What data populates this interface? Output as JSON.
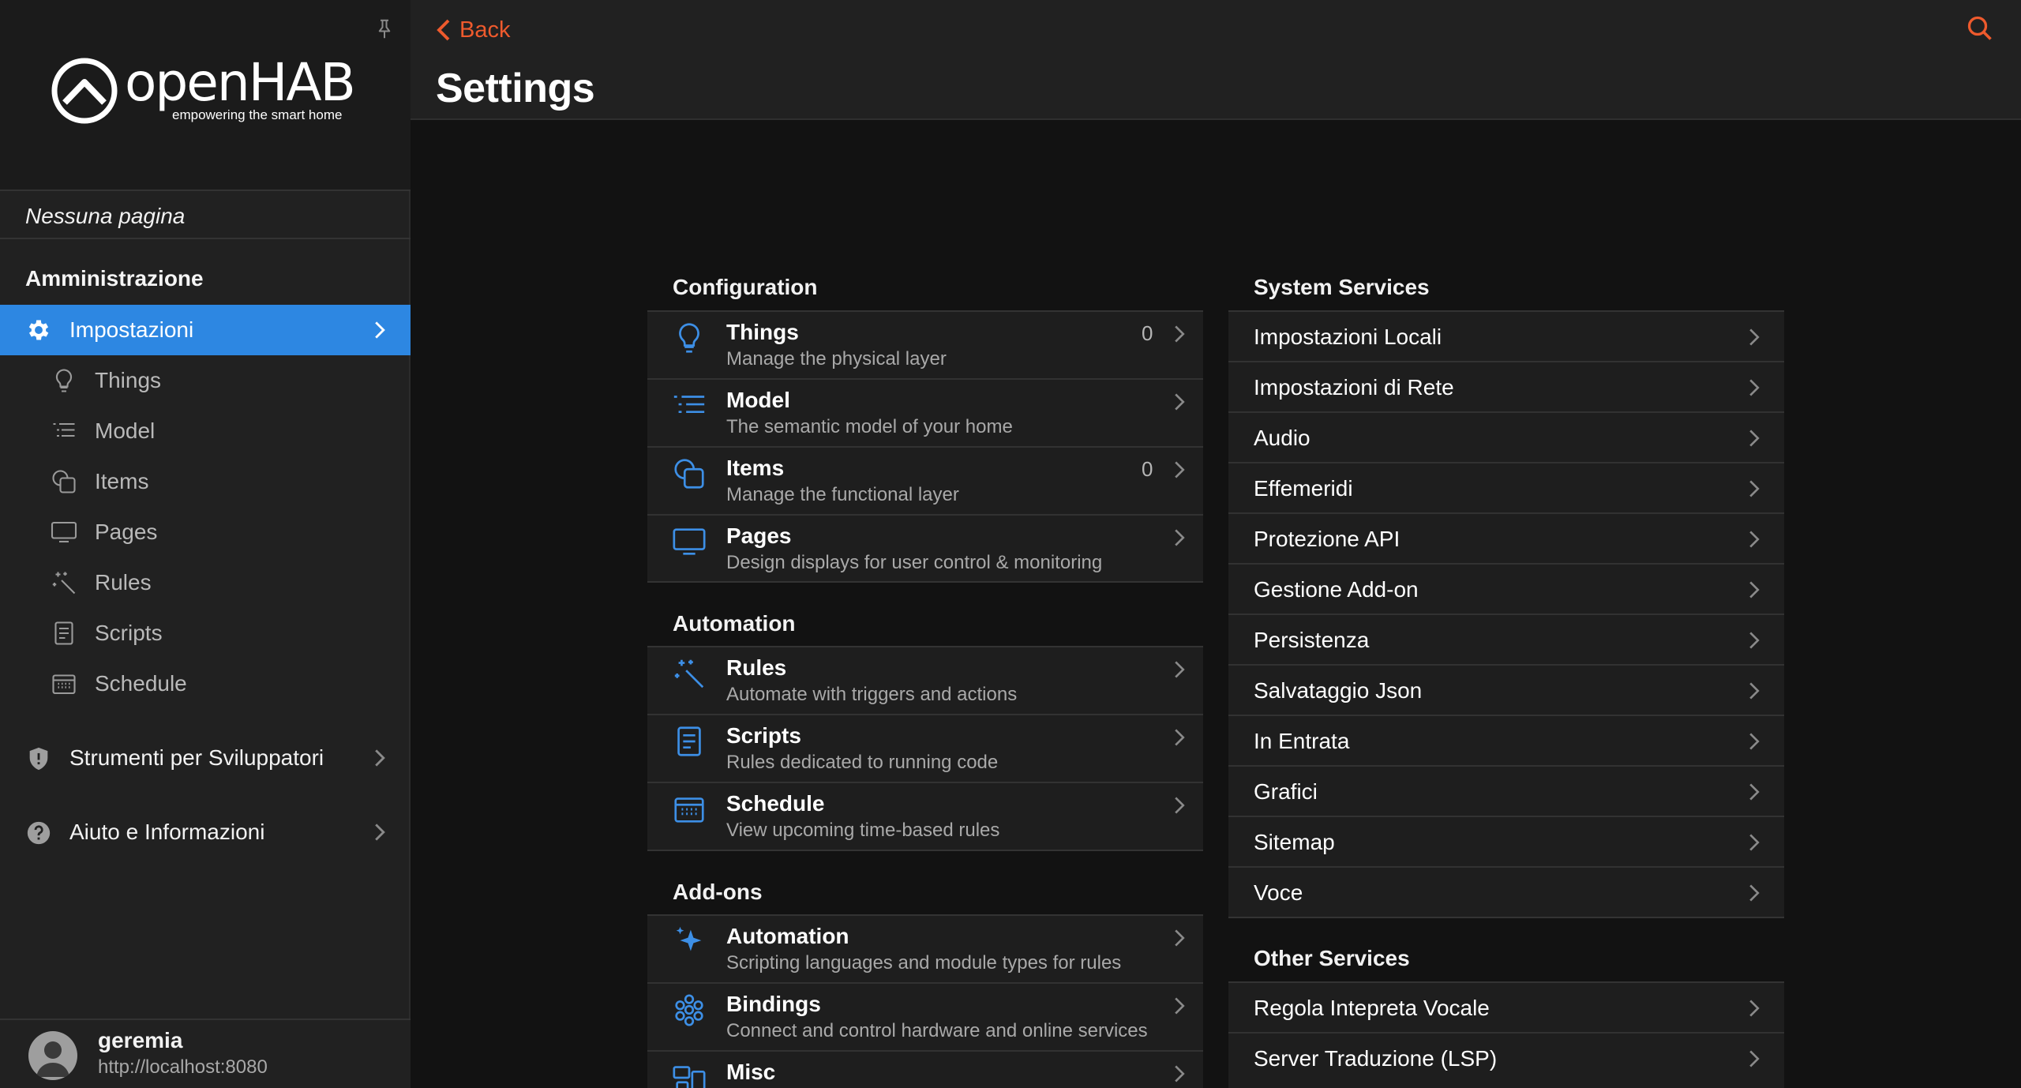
{
  "app": {
    "logo_text": "openHAB",
    "logo_tagline": "empowering the smart home"
  },
  "sidebar": {
    "no_page": "Nessuna pagina",
    "admin_title": "Amministrazione",
    "active_item": "Impostazioni",
    "subitems": [
      {
        "label": "Things",
        "icon": "lightbulb-icon"
      },
      {
        "label": "Model",
        "icon": "list-tree-icon"
      },
      {
        "label": "Items",
        "icon": "items-icon"
      },
      {
        "label": "Pages",
        "icon": "monitor-icon"
      },
      {
        "label": "Rules",
        "icon": "magic-wand-icon"
      },
      {
        "label": "Scripts",
        "icon": "document-icon"
      },
      {
        "label": "Schedule",
        "icon": "calendar-icon"
      }
    ],
    "groups": [
      {
        "label": "Strumenti per Sviluppatori",
        "icon": "shield-icon"
      },
      {
        "label": "Aiuto e Informazioni",
        "icon": "question-icon"
      }
    ],
    "user": {
      "name": "geremia",
      "url": "http://localhost:8080"
    }
  },
  "header": {
    "back_label": "Back",
    "title": "Settings"
  },
  "configuration": {
    "title": "Configuration",
    "rows": [
      {
        "title": "Things",
        "subtitle": "Manage the physical layer",
        "count": "0",
        "icon": "lightbulb-icon"
      },
      {
        "title": "Model",
        "subtitle": "The semantic model of your home",
        "count": "",
        "icon": "list-tree-icon"
      },
      {
        "title": "Items",
        "subtitle": "Manage the functional layer",
        "count": "0",
        "icon": "items-icon"
      },
      {
        "title": "Pages",
        "subtitle": "Design displays for user control & monitoring",
        "count": "",
        "icon": "monitor-icon"
      }
    ]
  },
  "automation": {
    "title": "Automation",
    "rows": [
      {
        "title": "Rules",
        "subtitle": "Automate with triggers and actions",
        "icon": "magic-wand-icon"
      },
      {
        "title": "Scripts",
        "subtitle": "Rules dedicated to running code",
        "icon": "document-icon"
      },
      {
        "title": "Schedule",
        "subtitle": "View upcoming time-based rules",
        "icon": "calendar-icon"
      }
    ]
  },
  "addons": {
    "title": "Add-ons",
    "rows": [
      {
        "title": "Automation",
        "subtitle": "Scripting languages and module types for rules",
        "icon": "sparkles-icon"
      },
      {
        "title": "Bindings",
        "subtitle": "Connect and control hardware and online services",
        "icon": "bindings-icon"
      },
      {
        "title": "Misc",
        "subtitle": "",
        "icon": "misc-icon"
      }
    ]
  },
  "system_services": {
    "title": "System Services",
    "items": [
      "Impostazioni Locali",
      "Impostazioni di Rete",
      "Audio",
      "Effemeridi",
      "Protezione API",
      "Gestione Add-on",
      "Persistenza",
      "Salvataggio Json",
      "In Entrata",
      "Grafici",
      "Sitemap",
      "Voce"
    ]
  },
  "other_services": {
    "title": "Other Services",
    "items": [
      "Regola Intepreta Vocale",
      "Server Traduzione (LSP)"
    ]
  },
  "colors": {
    "accent": "#2d87e2",
    "back_link": "#ee5a2d",
    "icon_blue": "#3d8fe6"
  }
}
